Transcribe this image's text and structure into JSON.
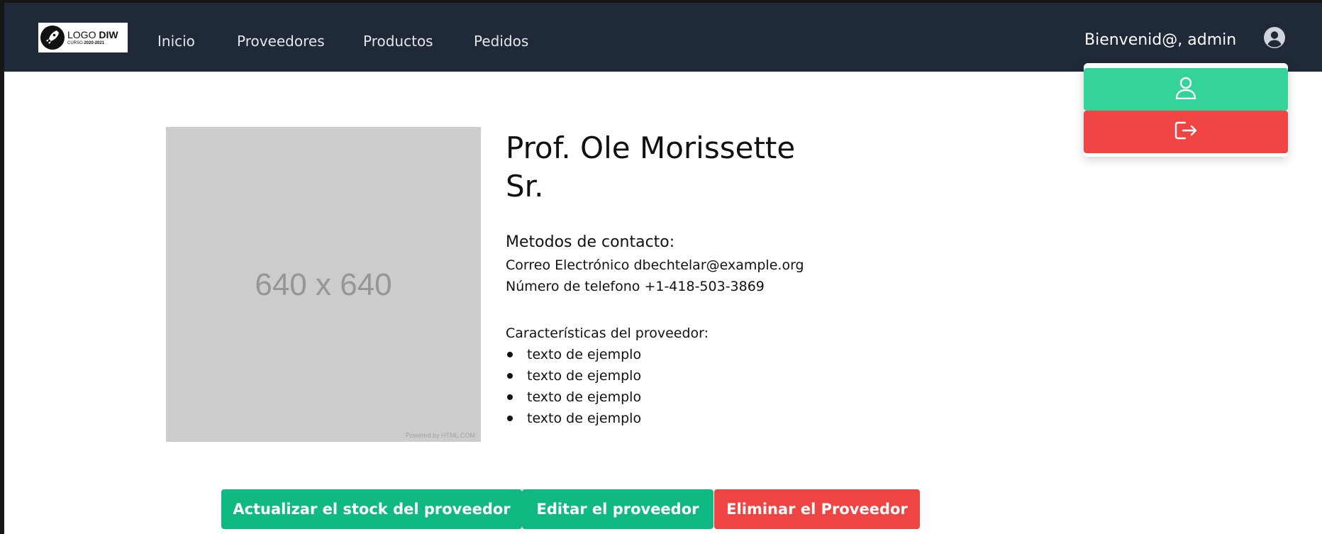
{
  "logo": {
    "title_light": "LOGO",
    "title_bold": "DIW",
    "subtitle_light": "CURSO",
    "subtitle_bold": "2020-2021"
  },
  "nav": {
    "links": [
      {
        "label": "Inicio"
      },
      {
        "label": "Proveedores"
      },
      {
        "label": "Productos"
      },
      {
        "label": "Pedidos"
      }
    ],
    "welcome": "Bienvenid@, admin"
  },
  "user_menu": {
    "items": [
      {
        "icon": "user-icon",
        "color": "#34d399"
      },
      {
        "icon": "logout-icon",
        "color": "#ef4444"
      }
    ]
  },
  "image_placeholder": {
    "label": "640 x 640",
    "powered": "Powered by HTML.COM"
  },
  "provider": {
    "name": "Prof. Ole Morissette Sr.",
    "contact_title": "Metodos de contacto:",
    "email_label": "Correo Electrónico",
    "email": "dbechtelar@example.org",
    "phone_label": "Número de telefono",
    "phone": "+1-418-503-3869",
    "features_title": "Características del proveedor:",
    "features": [
      "texto de ejemplo",
      "texto de ejemplo",
      "texto de ejemplo",
      "texto de ejemplo"
    ]
  },
  "actions": {
    "update_stock": "Actualizar el stock del proveedor",
    "edit": "Editar el proveedor",
    "delete": "Eliminar el Proveedor"
  },
  "colors": {
    "navbar": "#1f2937",
    "success": "#10b981",
    "danger": "#ef4444",
    "profile": "#34d399"
  }
}
